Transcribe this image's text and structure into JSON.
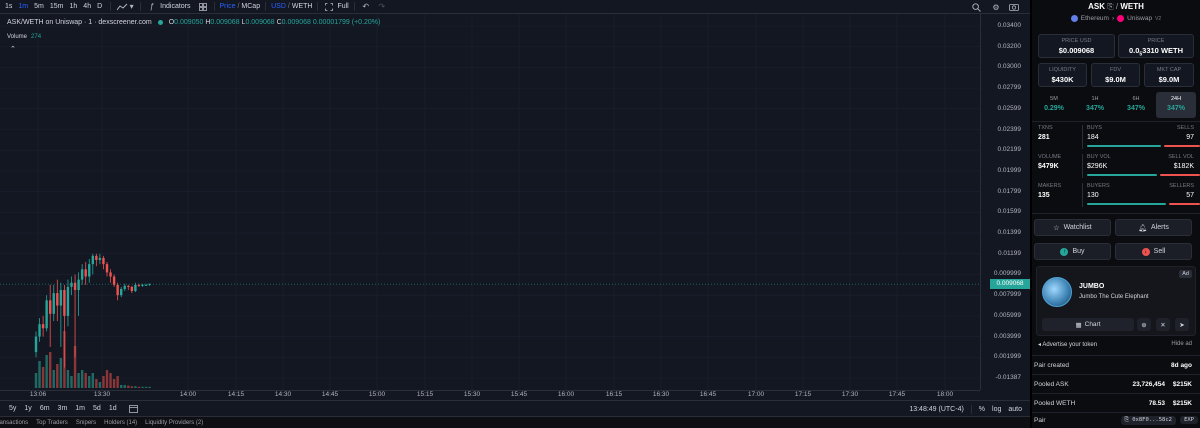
{
  "toolbar": {
    "timeframes": [
      "1s",
      "1m",
      "5m",
      "15m",
      "1h",
      "4h",
      "D"
    ],
    "active_timeframe": "1m",
    "indicators_label": "Indicators",
    "price_label": "Price",
    "slash": "/",
    "mcap_label": "MCap",
    "usd_label": "USD",
    "weth_label": "WETH",
    "full_label": "Full"
  },
  "chart": {
    "legend_title": "ASK/WETH on Uniswap · 1 · dexscreener.com",
    "o_label": "O",
    "o": "0.009050",
    "h_label": "H",
    "h": "0.009068",
    "l_label": "L",
    "l": "0.009068",
    "c_label": "C",
    "c": "0.009068",
    "change": "0.00001799 (+0.20%)",
    "volume_label": "Volume",
    "volume_value": "274",
    "current_price": "0.009068"
  },
  "chart_data": {
    "type": "candlestick",
    "title": "ASK/WETH on Uniswap · 1 · dexscreener.com",
    "y_ticks": [
      "0.03400",
      "0.03200",
      "0.03000",
      "0.02799",
      "0.02599",
      "0.02399",
      "0.02199",
      "0.01999",
      "0.01799",
      "0.01599",
      "0.01399",
      "0.01199",
      "0.009999",
      "0.007999",
      "0.005999",
      "0.003999",
      "0.001999",
      "-0.01387"
    ],
    "x_ticks": [
      "13:06",
      "13:30",
      "14:00",
      "14:15",
      "14:30",
      "14:45",
      "15:00",
      "15:15",
      "15:30",
      "15:45",
      "16:00",
      "16:15",
      "16:30",
      "16:45",
      "17:00",
      "17:15",
      "17:30",
      "17:45",
      "18:00"
    ],
    "ylim": [
      0,
      0.034
    ],
    "candles": [
      {
        "o": 0.0025,
        "c": 0.004,
        "h": 0.0045,
        "l": 0.002
      },
      {
        "o": 0.004,
        "c": 0.0052,
        "h": 0.0058,
        "l": 0.0035
      },
      {
        "o": 0.0052,
        "c": 0.0048,
        "h": 0.006,
        "l": 0.004
      },
      {
        "o": 0.0048,
        "c": 0.0075,
        "h": 0.008,
        "l": 0.0045
      },
      {
        "o": 0.0075,
        "c": 0.0062,
        "h": 0.009,
        "l": 0.003
      },
      {
        "o": 0.0062,
        "c": 0.0082,
        "h": 0.009,
        "l": 0.0055
      },
      {
        "o": 0.0082,
        "c": 0.007,
        "h": 0.0095,
        "l": 0.0055
      },
      {
        "o": 0.007,
        "c": 0.0085,
        "h": 0.0092,
        "l": 0.003
      },
      {
        "o": 0.0085,
        "c": 0.006,
        "h": 0.009,
        "l": 0.001
      },
      {
        "o": 0.006,
        "c": 0.0088,
        "h": 0.0095,
        "l": 0.005
      },
      {
        "o": 0.0088,
        "c": 0.0092,
        "h": 0.0098,
        "l": 0.008
      },
      {
        "o": 0.0092,
        "c": 0.0085,
        "h": 0.01,
        "l": 0.002
      },
      {
        "o": 0.0085,
        "c": 0.0095,
        "h": 0.0102,
        "l": 0.006
      },
      {
        "o": 0.0095,
        "c": 0.0105,
        "h": 0.011,
        "l": 0.009
      },
      {
        "o": 0.0105,
        "c": 0.0098,
        "h": 0.0112,
        "l": 0.009
      },
      {
        "o": 0.0098,
        "c": 0.011,
        "h": 0.0115,
        "l": 0.0092
      },
      {
        "o": 0.011,
        "c": 0.0118,
        "h": 0.012,
        "l": 0.01
      },
      {
        "o": 0.0118,
        "c": 0.0114,
        "h": 0.012,
        "l": 0.0108
      },
      {
        "o": 0.0114,
        "c": 0.0116,
        "h": 0.012,
        "l": 0.011
      },
      {
        "o": 0.0116,
        "c": 0.011,
        "h": 0.0118,
        "l": 0.0105
      },
      {
        "o": 0.011,
        "c": 0.0102,
        "h": 0.0112,
        "l": 0.0098
      },
      {
        "o": 0.0102,
        "c": 0.0098,
        "h": 0.0105,
        "l": 0.0092
      },
      {
        "o": 0.0098,
        "c": 0.009,
        "h": 0.01,
        "l": 0.0088
      },
      {
        "o": 0.009,
        "c": 0.008,
        "h": 0.0092,
        "l": 0.0075
      },
      {
        "o": 0.008,
        "c": 0.0086,
        "h": 0.0088,
        "l": 0.0078
      },
      {
        "o": 0.0086,
        "c": 0.0089,
        "h": 0.0091,
        "l": 0.0084
      },
      {
        "o": 0.0089,
        "c": 0.0088,
        "h": 0.009,
        "l": 0.0085
      },
      {
        "o": 0.0088,
        "c": 0.0084,
        "h": 0.0089,
        "l": 0.0082
      },
      {
        "o": 0.0084,
        "c": 0.009,
        "h": 0.0092,
        "l": 0.0083
      },
      {
        "o": 0.009,
        "c": 0.0089,
        "h": 0.0091,
        "l": 0.0088
      },
      {
        "o": 0.0089,
        "c": 0.009,
        "h": 0.0091,
        "l": 0.0088
      },
      {
        "o": 0.009,
        "c": 0.009,
        "h": 0.0091,
        "l": 0.0089
      },
      {
        "o": 0.009,
        "c": 0.0091,
        "h": 0.0091,
        "l": 0.0089
      }
    ],
    "volumes": [
      0.25,
      0.45,
      0.35,
      0.55,
      0.6,
      0.3,
      0.4,
      0.5,
      0.95,
      0.3,
      0.2,
      0.7,
      0.25,
      0.3,
      0.25,
      0.2,
      0.25,
      0.15,
      0.1,
      0.2,
      0.3,
      0.25,
      0.15,
      0.2,
      0.05,
      0.05,
      0.04,
      0.03,
      0.03,
      0.02,
      0.02,
      0.02,
      0.02
    ],
    "volume_up": [
      true,
      true,
      false,
      true,
      false,
      true,
      false,
      true,
      false,
      true,
      true,
      false,
      true,
      true,
      false,
      true,
      true,
      false,
      true,
      false,
      false,
      false,
      false,
      false,
      true,
      true,
      false,
      false,
      true,
      false,
      true,
      true,
      true
    ]
  },
  "bottom": {
    "ranges": [
      "5y",
      "1y",
      "6m",
      "3m",
      "1m",
      "5d",
      "1d"
    ],
    "time": "13:48:49 (UTC-4)",
    "pct": "%",
    "log": "log",
    "auto": "auto"
  },
  "tabs": [
    "Transactions",
    "Top Traders",
    "Snipers",
    "Holders (14)",
    "Liquidity Providers (2)"
  ],
  "sidebar": {
    "pair_base": "ASK",
    "pair_sep": "/",
    "pair_quote": "WETH",
    "chain": "Ethereum",
    "dex": "Uniswap",
    "dex_version": "V2",
    "price_usd_label": "PRICE USD",
    "price_usd": "$0.009068",
    "price_label": "PRICE",
    "price_prefix": "0.0",
    "price_sub": "5",
    "price_rest": "3310 WETH",
    "liquidity_label": "LIQUIDITY",
    "liquidity": "$430K",
    "fdv_label": "FDV",
    "fdv": "$9.0M",
    "mcap_label": "MKT CAP",
    "mcap": "$9.0M",
    "changes": [
      {
        "label": "5M",
        "value": "0.29%"
      },
      {
        "label": "1H",
        "value": "347%"
      },
      {
        "label": "6H",
        "value": "347%"
      },
      {
        "label": "24H",
        "value": "347%"
      }
    ],
    "txns_label": "TXNS",
    "txns": "281",
    "buys_label": "BUYS",
    "buys": "184",
    "sells_label": "SELLS",
    "sells": "97",
    "volume_label": "VOLUME",
    "volume": "$479K",
    "buy_vol_label": "BUY VOL",
    "buy_vol": "$296K",
    "sell_vol_label": "SELL VOL",
    "sell_vol": "$182K",
    "makers_label": "MAKERS",
    "makers": "135",
    "buyers_label": "BUYERS",
    "buyers": "130",
    "sellers_label": "SELLERS",
    "sellers": "57",
    "buys_share": 0.655,
    "buy_vol_share": 0.62,
    "buyers_share": 0.695,
    "watchlist": "Watchlist",
    "alerts": "Alerts",
    "buy": "Buy",
    "sell": "Sell",
    "ad": {
      "tag": "Ad",
      "name": "JUMBO",
      "desc": "Jumbo The Cute Elephant",
      "chart": "Chart"
    },
    "advertise": "Advertise your token",
    "hide_ad": "Hide ad",
    "info": [
      {
        "label": "Pair created",
        "value": "8d ago"
      },
      {
        "label": "Pooled ASK",
        "value": "23,726,454",
        "value2": "$215K"
      },
      {
        "label": "Pooled WETH",
        "value": "78.53",
        "value2": "$215K"
      },
      {
        "label": "Pair",
        "addr": "0x8F0...58c2",
        "exp": "EXP"
      }
    ]
  },
  "colors": {
    "up": "#26a69a",
    "down": "#ef5350",
    "bg": "#131722",
    "accent": "#2962ff"
  }
}
